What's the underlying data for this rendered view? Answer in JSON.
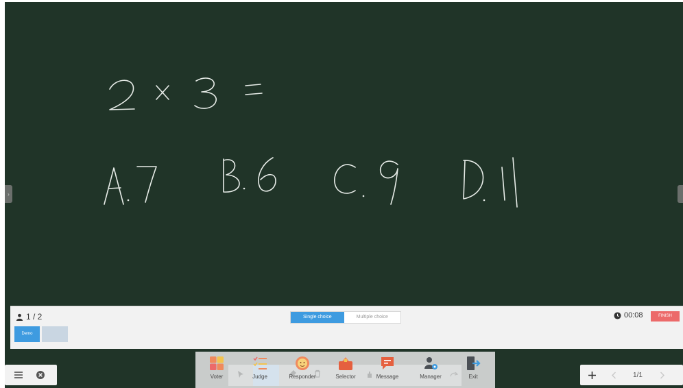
{
  "board": {
    "background_color": "#203428",
    "question": "2 X 3 =",
    "options": [
      "A. 7",
      "B. 6",
      "C. 9",
      "D. 11"
    ]
  },
  "vote_panel": {
    "answered_count": "1 / 2",
    "modes": [
      "Single choice",
      "Multiple choice"
    ],
    "selected_mode": "Single choice",
    "timer": "00:08",
    "finish_label": "FINISH",
    "students": [
      "Demo"
    ]
  },
  "toolbar": {
    "tools": [
      {
        "label": "Voter",
        "icon": "voter-icon"
      },
      {
        "label": "Judge",
        "icon": "judge-icon"
      },
      {
        "label": "Responder",
        "icon": "responder-icon"
      },
      {
        "label": "Selector",
        "icon": "selector-icon"
      },
      {
        "label": "Message",
        "icon": "message-icon"
      },
      {
        "label": "Manager",
        "icon": "manager-icon"
      },
      {
        "label": "Exit",
        "icon": "exit-icon"
      }
    ]
  },
  "bottom_left": {
    "menu_icon": "hamburger-icon",
    "close_icon": "close-circle-icon"
  },
  "bottom_right": {
    "page": "1/1",
    "add_icon": "plus-icon"
  },
  "colors": {
    "accent": "#3e9be0",
    "finish": "#ec6a6a",
    "chalk": "#e7ece8"
  }
}
